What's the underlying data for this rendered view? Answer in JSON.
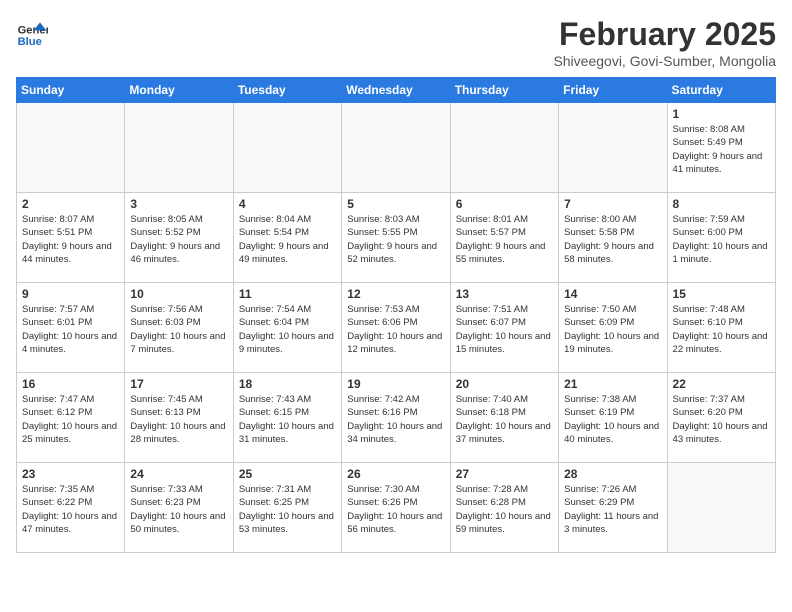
{
  "header": {
    "logo_general": "General",
    "logo_blue": "Blue",
    "month_year": "February 2025",
    "location": "Shiveegovi, Govi-Sumber, Mongolia"
  },
  "days_of_week": [
    "Sunday",
    "Monday",
    "Tuesday",
    "Wednesday",
    "Thursday",
    "Friday",
    "Saturday"
  ],
  "weeks": [
    [
      {
        "day": "",
        "info": ""
      },
      {
        "day": "",
        "info": ""
      },
      {
        "day": "",
        "info": ""
      },
      {
        "day": "",
        "info": ""
      },
      {
        "day": "",
        "info": ""
      },
      {
        "day": "",
        "info": ""
      },
      {
        "day": "1",
        "info": "Sunrise: 8:08 AM\nSunset: 5:49 PM\nDaylight: 9 hours and 41 minutes."
      }
    ],
    [
      {
        "day": "2",
        "info": "Sunrise: 8:07 AM\nSunset: 5:51 PM\nDaylight: 9 hours and 44 minutes."
      },
      {
        "day": "3",
        "info": "Sunrise: 8:05 AM\nSunset: 5:52 PM\nDaylight: 9 hours and 46 minutes."
      },
      {
        "day": "4",
        "info": "Sunrise: 8:04 AM\nSunset: 5:54 PM\nDaylight: 9 hours and 49 minutes."
      },
      {
        "day": "5",
        "info": "Sunrise: 8:03 AM\nSunset: 5:55 PM\nDaylight: 9 hours and 52 minutes."
      },
      {
        "day": "6",
        "info": "Sunrise: 8:01 AM\nSunset: 5:57 PM\nDaylight: 9 hours and 55 minutes."
      },
      {
        "day": "7",
        "info": "Sunrise: 8:00 AM\nSunset: 5:58 PM\nDaylight: 9 hours and 58 minutes."
      },
      {
        "day": "8",
        "info": "Sunrise: 7:59 AM\nSunset: 6:00 PM\nDaylight: 10 hours and 1 minute."
      }
    ],
    [
      {
        "day": "9",
        "info": "Sunrise: 7:57 AM\nSunset: 6:01 PM\nDaylight: 10 hours and 4 minutes."
      },
      {
        "day": "10",
        "info": "Sunrise: 7:56 AM\nSunset: 6:03 PM\nDaylight: 10 hours and 7 minutes."
      },
      {
        "day": "11",
        "info": "Sunrise: 7:54 AM\nSunset: 6:04 PM\nDaylight: 10 hours and 9 minutes."
      },
      {
        "day": "12",
        "info": "Sunrise: 7:53 AM\nSunset: 6:06 PM\nDaylight: 10 hours and 12 minutes."
      },
      {
        "day": "13",
        "info": "Sunrise: 7:51 AM\nSunset: 6:07 PM\nDaylight: 10 hours and 15 minutes."
      },
      {
        "day": "14",
        "info": "Sunrise: 7:50 AM\nSunset: 6:09 PM\nDaylight: 10 hours and 19 minutes."
      },
      {
        "day": "15",
        "info": "Sunrise: 7:48 AM\nSunset: 6:10 PM\nDaylight: 10 hours and 22 minutes."
      }
    ],
    [
      {
        "day": "16",
        "info": "Sunrise: 7:47 AM\nSunset: 6:12 PM\nDaylight: 10 hours and 25 minutes."
      },
      {
        "day": "17",
        "info": "Sunrise: 7:45 AM\nSunset: 6:13 PM\nDaylight: 10 hours and 28 minutes."
      },
      {
        "day": "18",
        "info": "Sunrise: 7:43 AM\nSunset: 6:15 PM\nDaylight: 10 hours and 31 minutes."
      },
      {
        "day": "19",
        "info": "Sunrise: 7:42 AM\nSunset: 6:16 PM\nDaylight: 10 hours and 34 minutes."
      },
      {
        "day": "20",
        "info": "Sunrise: 7:40 AM\nSunset: 6:18 PM\nDaylight: 10 hours and 37 minutes."
      },
      {
        "day": "21",
        "info": "Sunrise: 7:38 AM\nSunset: 6:19 PM\nDaylight: 10 hours and 40 minutes."
      },
      {
        "day": "22",
        "info": "Sunrise: 7:37 AM\nSunset: 6:20 PM\nDaylight: 10 hours and 43 minutes."
      }
    ],
    [
      {
        "day": "23",
        "info": "Sunrise: 7:35 AM\nSunset: 6:22 PM\nDaylight: 10 hours and 47 minutes."
      },
      {
        "day": "24",
        "info": "Sunrise: 7:33 AM\nSunset: 6:23 PM\nDaylight: 10 hours and 50 minutes."
      },
      {
        "day": "25",
        "info": "Sunrise: 7:31 AM\nSunset: 6:25 PM\nDaylight: 10 hours and 53 minutes."
      },
      {
        "day": "26",
        "info": "Sunrise: 7:30 AM\nSunset: 6:26 PM\nDaylight: 10 hours and 56 minutes."
      },
      {
        "day": "27",
        "info": "Sunrise: 7:28 AM\nSunset: 6:28 PM\nDaylight: 10 hours and 59 minutes."
      },
      {
        "day": "28",
        "info": "Sunrise: 7:26 AM\nSunset: 6:29 PM\nDaylight: 11 hours and 3 minutes."
      },
      {
        "day": "",
        "info": ""
      }
    ]
  ]
}
